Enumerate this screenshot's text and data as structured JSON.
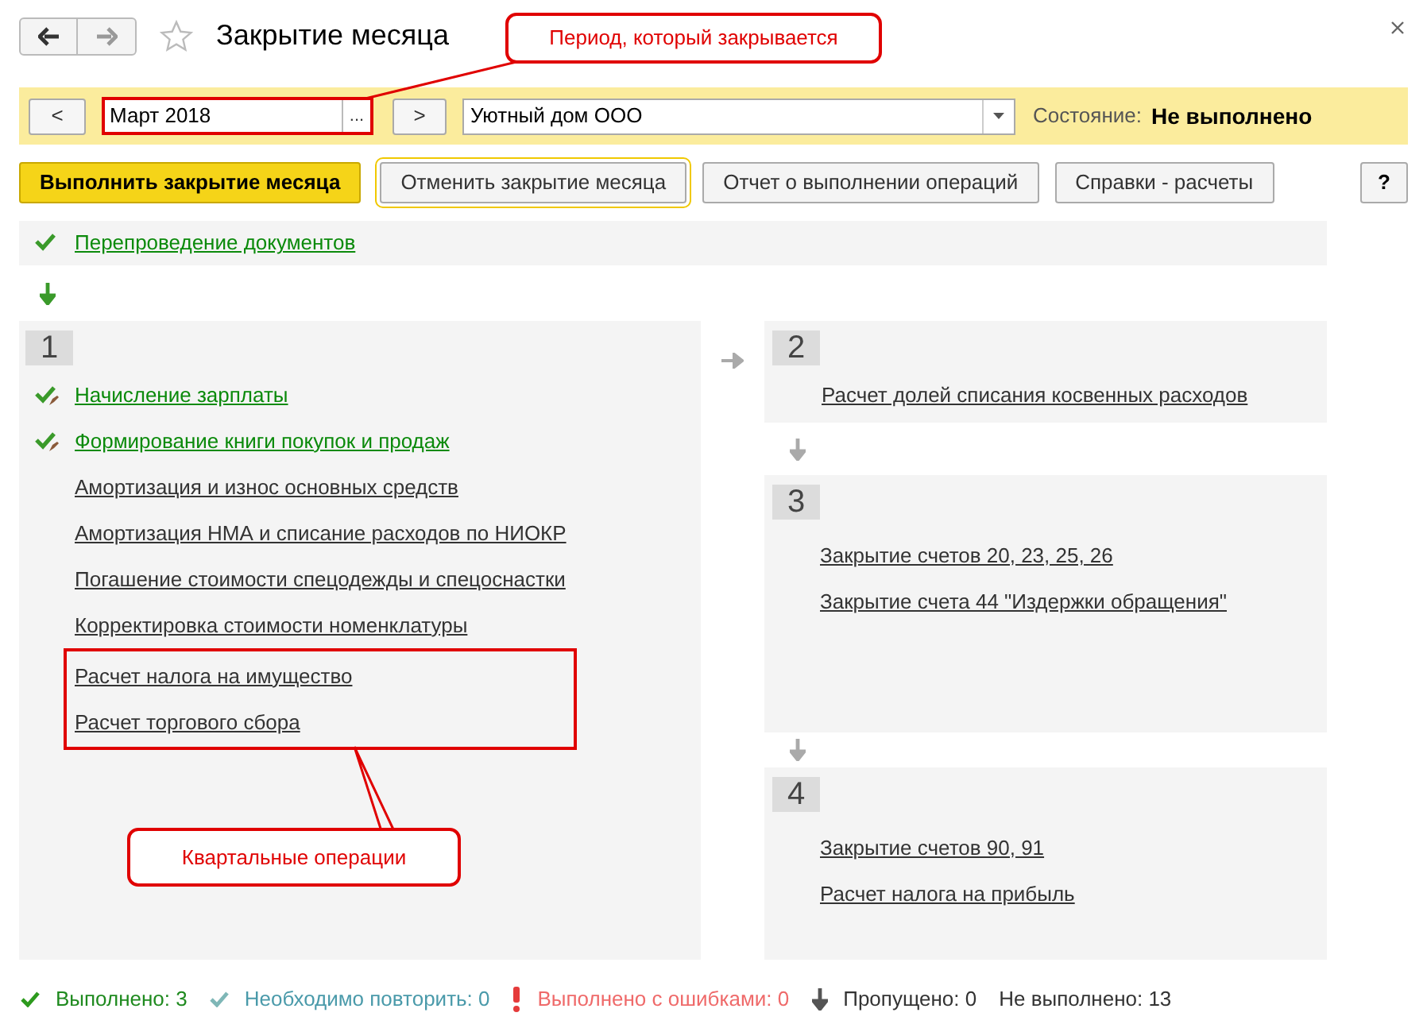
{
  "window": {
    "title": "Закрытие месяца"
  },
  "toolbar": {
    "prev": "<",
    "period": "Март 2018",
    "period_button": "...",
    "next": ">",
    "organization": "Уютный дом ООО",
    "status_label": "Состояние:",
    "status_value": "Не выполнено"
  },
  "buttons": [
    {
      "label": "Выполнить закрытие месяца",
      "kind": "primary"
    },
    {
      "label": "Отменить закрытие месяца",
      "kind": "focused"
    },
    {
      "label": "Отчет о выполнении операций",
      "kind": "normal"
    },
    {
      "label": "Справки - расчеты",
      "kind": "normal"
    }
  ],
  "help": "?",
  "preliminary": [
    {
      "label": "Перепроведение документов",
      "done": true,
      "edited": false
    }
  ],
  "stages": [
    {
      "number": "1",
      "items": [
        {
          "label": "Начисление зарплаты",
          "done": true,
          "edited": true
        },
        {
          "label": "Формирование книги покупок и продаж",
          "done": true,
          "edited": true
        },
        {
          "label": "Амортизация и износ основных средств",
          "done": false,
          "edited": false
        },
        {
          "label": "Амортизация НМА и списание расходов по НИОКР",
          "done": false,
          "edited": false
        },
        {
          "label": "Погашение стоимости спецодежды и спецоснастки",
          "done": false,
          "edited": false
        },
        {
          "label": "Корректировка стоимости номенклатуры",
          "done": false,
          "edited": false
        }
      ],
      "highlighted_items": [
        {
          "label": "Расчет налога на имущество",
          "done": false,
          "edited": false
        },
        {
          "label": "Расчет торгового сбора",
          "done": false,
          "edited": false
        }
      ]
    },
    {
      "number": "2",
      "items": [
        {
          "label": "Расчет долей списания косвенных расходов",
          "done": false,
          "edited": false
        }
      ]
    },
    {
      "number": "3",
      "items": [
        {
          "label": "Закрытие счетов 20, 23, 25, 26",
          "done": false,
          "edited": false
        },
        {
          "label": "Закрытие счета 44 \"Издержки обращения\"",
          "done": false,
          "edited": false
        }
      ]
    },
    {
      "number": "4",
      "items": [
        {
          "label": "Закрытие счетов 90, 91",
          "done": false,
          "edited": false
        },
        {
          "label": "Расчет налога на прибыль",
          "done": false,
          "edited": false
        }
      ]
    }
  ],
  "summary": [
    {
      "kind": "done",
      "text": "Выполнено: 3"
    },
    {
      "kind": "repeat",
      "text": "Необходимо повторить: 0"
    },
    {
      "kind": "error",
      "text": "Выполнено с ошибками: 0"
    },
    {
      "kind": "skipped",
      "text": "Пропущено: 0"
    },
    {
      "kind": "pending",
      "text": "Не выполнено: 13"
    }
  ],
  "annotations": {
    "period": "Период, который закрывается",
    "quarterly": "Квартальные операции"
  }
}
